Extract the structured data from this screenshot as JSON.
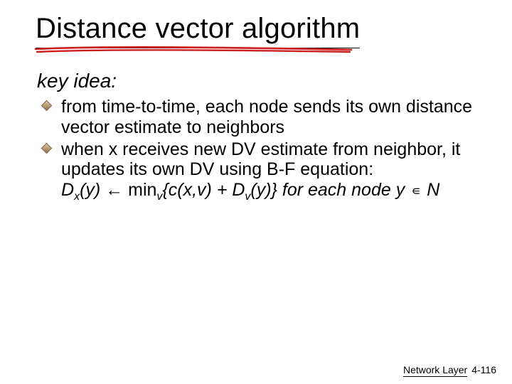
{
  "slide": {
    "title": "Distance vector algorithm",
    "key_idea_label": "key idea:",
    "bullets": [
      "from time-to-time, each node sends its own distance vector estimate to neighbors",
      "when x receives new DV estimate from neighbor, it updates its own DV using B-F equation:"
    ],
    "equation": {
      "lhs_D": "D",
      "lhs_x": "x",
      "lhs_y": "(y)",
      "arrow": " ← ",
      "min": "min",
      "min_v": "v",
      "brace_open": "{c(x,v)  +  D",
      "Dv_v": "v",
      "Dv_y": "(y)}",
      "for_each": "  for each node y ",
      "in": "∊",
      "N": " N"
    }
  },
  "footer": {
    "chapter": "Network Layer",
    "page": "4-116"
  }
}
